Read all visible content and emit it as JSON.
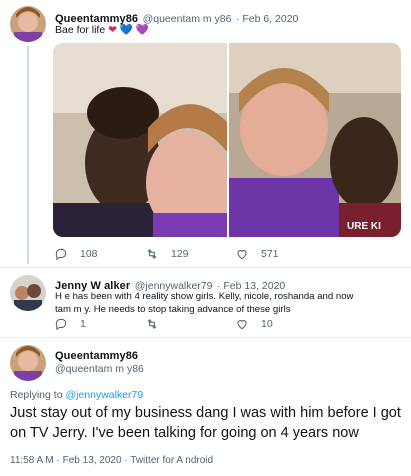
{
  "tweet1": {
    "name": "Queentammy86",
    "handle": "@queentam m y86",
    "date": "· Feb 6, 2020",
    "text": "Bae for life",
    "emoji": [
      "❤",
      "💙",
      "💜"
    ],
    "stats": {
      "replies": "108",
      "retweets": "129",
      "likes": "571"
    }
  },
  "tweet2": {
    "name": "Jenny W alker",
    "handle": "@jennywalker79",
    "date": "· Feb 13, 2020",
    "text_line1": "H e has been with 4 reality show girls.  Kelly, nicole, roshanda  and now",
    "text_line2": "tam m y.  He needs to stop taking advance of these girls",
    "stats": {
      "replies": "1",
      "likes": "10"
    }
  },
  "tweet3": {
    "name": "Queentammy86",
    "handle": "@queentam m y86",
    "replying_prefix": "Replying to",
    "replying_to": "@jennywalker79",
    "text": "Just stay out of my business dang I was with him before I got on TV Jerry. I've been talking for going on 4 years now",
    "meta": "11:58 A M  · Feb 13, 2020  · Twitter for A ndroid"
  },
  "icons": [
    "reply-icon",
    "retweet-icon",
    "like-icon"
  ],
  "colors": {
    "accent": "#1d9bf0",
    "muted": "#536471",
    "divider": "#e6ecf0"
  }
}
